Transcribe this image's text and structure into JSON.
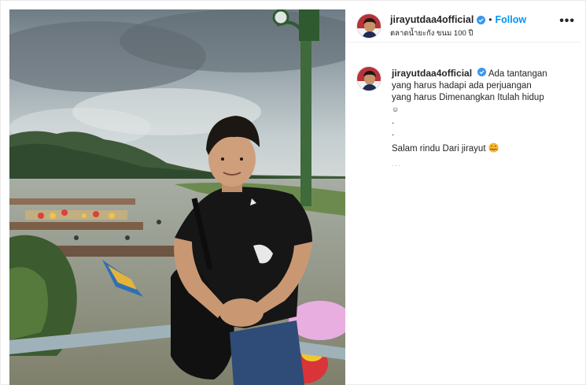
{
  "post": {
    "username": "jirayutdaa4official",
    "follow_label": "Follow",
    "separator": "•",
    "location": "ตลาดน้ำยะกัง ขนม 100 ปี",
    "more_label": "•••"
  },
  "caption": {
    "username": "jirayutdaa4official",
    "line1": "Ada tantangan",
    "line2": "yang harus hadapi ada perjuangan",
    "line3": "yang harus Dimenangkan Itulah hidup",
    "line4": "☺",
    "line5": ".",
    "line6": ".",
    "line7": "Salam rindu Dari jirayut",
    "line8": ". . ."
  },
  "colors": {
    "accent": "#0095f6",
    "verified": "#3897f0",
    "text": "#262626"
  },
  "icons": {
    "verified": "verified-badge-icon",
    "more": "more-options-icon",
    "emoji": "smiling-face-with-hearts-icon"
  }
}
